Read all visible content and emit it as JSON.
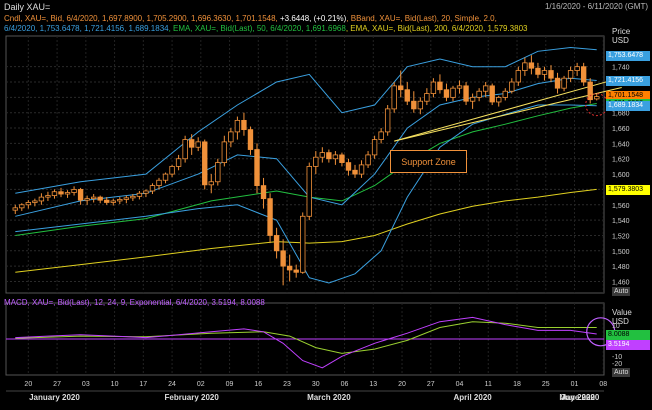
{
  "window": {
    "title": "Daily XAU=",
    "date_range": "1/16/2020 - 6/11/2020 (GMT)"
  },
  "legend": {
    "line1": [
      {
        "text": "Cndl, XAU=, Bid, 6/4/2020, 1,697.8900, 1,705.2900, 1,696.3630, 1,701.1548, ",
        "color": "#f0913a"
      },
      {
        "text": "+3.6448, (+0.21%)",
        "color": "#ffffff"
      },
      {
        "text": ", BBand, XAU=, Bid(Last), 20, Simple, 2.0,",
        "color": "#f0913a"
      }
    ],
    "line2": [
      {
        "text": "6/4/2020, 1,753.6478, 1,721.4156, 1,689.1834",
        "color": "#3aa0e0"
      },
      {
        "text": ", EMA, XAU=, Bid(Last), 50, 6/4/2020, 1,691.6968",
        "color": "#22c040"
      },
      {
        "text": ", EMA, XAU=, Bid(Last), 200, 6/4/2020, 1,579.3803",
        "color": "#e0d020"
      }
    ]
  },
  "price_axis": {
    "title": "Price",
    "unit": "USD",
    "ticks": [
      "1,740",
      "1,720",
      "1,700",
      "1,680",
      "1,660",
      "1,640",
      "1,620",
      "1,600",
      "1,580",
      "1,560",
      "1,540",
      "1,520",
      "1,500",
      "1,480",
      "1,460"
    ],
    "auto_label": "Auto",
    "badges": [
      {
        "value": "1,753.6478",
        "color": "#3aa0e0",
        "text_color": "#ffffff",
        "price": 1753.6
      },
      {
        "value": "1,721.4156",
        "color": "#3aa0e0",
        "text_color": "#ffffff",
        "price": 1721.4
      },
      {
        "value": "1,701.1548",
        "color": "#ff8000",
        "text_color": "#000000",
        "price": 1701.2
      },
      {
        "value": "1,691.6968",
        "color": "#22c040",
        "text_color": "#000000",
        "price": 1691.7
      },
      {
        "value": "1,689.1834",
        "color": "#3aa0e0",
        "text_color": "#ffffff",
        "price": 1689.2
      },
      {
        "value": "1,579.3803",
        "color": "#ffff00",
        "text_color": "#000000",
        "price": 1579.4
      }
    ]
  },
  "annotation": {
    "text": "Support Zone"
  },
  "macd": {
    "legend": "MACD, XAU=, Bid(Last), 12, 24, 9, Exponential, 6/4/2020, 3.5194, 8.0088",
    "axis_title": "Value",
    "unit": "USD",
    "ticks": [
      "10",
      "-10",
      "-20"
    ],
    "auto_label": "Auto",
    "badges": [
      {
        "value": "8.0088",
        "color": "#22c040",
        "text_color": "#000000"
      },
      {
        "value": "3.5194",
        "color": "#c040ff",
        "text_color": "#ffffff"
      }
    ]
  },
  "x_axis": {
    "days": [
      "20",
      "27",
      "03",
      "10",
      "17",
      "24",
      "02",
      "09",
      "16",
      "23",
      "30",
      "06",
      "13",
      "20",
      "27",
      "04",
      "11",
      "18",
      "25",
      "01",
      "08"
    ],
    "months": [
      "January 2020",
      "February 2020",
      "March 2020",
      "April 2020",
      "May 2020",
      "June 2020"
    ]
  },
  "colors": {
    "candle": "#f0913a",
    "bband": "#3aa0e0",
    "ema50": "#22c040",
    "ema200": "#e0d020",
    "macd": "#c040ff",
    "signal": "#9ad030"
  },
  "chart_data": {
    "type": "candlestick",
    "instrument": "XAU=",
    "x_start": "2020-01-16",
    "price_range": [
      1445,
      1780
    ],
    "candles": [
      [
        1553,
        1560,
        1548,
        1556
      ],
      [
        1556,
        1562,
        1552,
        1560
      ],
      [
        1560,
        1566,
        1555,
        1563
      ],
      [
        1563,
        1568,
        1558,
        1565
      ],
      [
        1565,
        1575,
        1560,
        1570
      ],
      [
        1570,
        1577,
        1565,
        1572
      ],
      [
        1572,
        1580,
        1568,
        1577
      ],
      [
        1577,
        1582,
        1570,
        1574
      ],
      [
        1574,
        1579,
        1569,
        1576
      ],
      [
        1576,
        1584,
        1572,
        1580
      ],
      [
        1580,
        1582,
        1560,
        1566
      ],
      [
        1566,
        1572,
        1560,
        1568
      ],
      [
        1568,
        1574,
        1563,
        1570
      ],
      [
        1570,
        1572,
        1562,
        1566
      ],
      [
        1566,
        1570,
        1560,
        1563
      ],
      [
        1563,
        1568,
        1559,
        1565
      ],
      [
        1565,
        1570,
        1561,
        1567
      ],
      [
        1567,
        1572,
        1562,
        1569
      ],
      [
        1569,
        1574,
        1565,
        1571
      ],
      [
        1571,
        1578,
        1567,
        1575
      ],
      [
        1575,
        1580,
        1570,
        1578
      ],
      [
        1578,
        1588,
        1574,
        1585
      ],
      [
        1585,
        1595,
        1580,
        1592
      ],
      [
        1592,
        1602,
        1588,
        1600
      ],
      [
        1600,
        1612,
        1596,
        1610
      ],
      [
        1610,
        1625,
        1605,
        1620
      ],
      [
        1620,
        1650,
        1615,
        1645
      ],
      [
        1645,
        1652,
        1625,
        1635
      ],
      [
        1635,
        1648,
        1630,
        1642
      ],
      [
        1642,
        1645,
        1580,
        1586
      ],
      [
        1586,
        1600,
        1575,
        1590
      ],
      [
        1590,
        1620,
        1585,
        1615
      ],
      [
        1615,
        1650,
        1610,
        1642
      ],
      [
        1642,
        1660,
        1635,
        1655
      ],
      [
        1655,
        1675,
        1645,
        1670
      ],
      [
        1670,
        1680,
        1650,
        1658
      ],
      [
        1658,
        1662,
        1625,
        1632
      ],
      [
        1632,
        1640,
        1575,
        1585
      ],
      [
        1585,
        1595,
        1555,
        1568
      ],
      [
        1568,
        1575,
        1510,
        1520
      ],
      [
        1520,
        1530,
        1490,
        1500
      ],
      [
        1500,
        1515,
        1455,
        1480
      ],
      [
        1480,
        1495,
        1460,
        1475
      ],
      [
        1475,
        1482,
        1465,
        1472
      ],
      [
        1472,
        1550,
        1470,
        1545
      ],
      [
        1545,
        1615,
        1540,
        1610
      ],
      [
        1610,
        1630,
        1600,
        1622
      ],
      [
        1622,
        1635,
        1615,
        1628
      ],
      [
        1628,
        1632,
        1615,
        1620
      ],
      [
        1620,
        1630,
        1612,
        1625
      ],
      [
        1625,
        1628,
        1610,
        1615
      ],
      [
        1615,
        1620,
        1598,
        1605
      ],
      [
        1605,
        1612,
        1595,
        1600
      ],
      [
        1600,
        1618,
        1595,
        1612
      ],
      [
        1612,
        1630,
        1608,
        1625
      ],
      [
        1625,
        1650,
        1620,
        1645
      ],
      [
        1645,
        1660,
        1640,
        1655
      ],
      [
        1655,
        1690,
        1650,
        1685
      ],
      [
        1685,
        1720,
        1680,
        1715
      ],
      [
        1715,
        1735,
        1700,
        1710
      ],
      [
        1710,
        1720,
        1690,
        1695
      ],
      [
        1695,
        1708,
        1680,
        1685
      ],
      [
        1685,
        1700,
        1678,
        1695
      ],
      [
        1695,
        1712,
        1690,
        1705
      ],
      [
        1705,
        1725,
        1700,
        1720
      ],
      [
        1720,
        1730,
        1705,
        1710
      ],
      [
        1710,
        1718,
        1695,
        1700
      ],
      [
        1700,
        1715,
        1695,
        1712
      ],
      [
        1712,
        1722,
        1705,
        1715
      ],
      [
        1715,
        1720,
        1690,
        1695
      ],
      [
        1695,
        1705,
        1685,
        1700
      ],
      [
        1700,
        1712,
        1695,
        1708
      ],
      [
        1708,
        1720,
        1700,
        1715
      ],
      [
        1715,
        1718,
        1690,
        1694
      ],
      [
        1694,
        1702,
        1688,
        1700
      ],
      [
        1700,
        1712,
        1696,
        1708
      ],
      [
        1708,
        1725,
        1705,
        1720
      ],
      [
        1720,
        1740,
        1715,
        1735
      ],
      [
        1735,
        1752,
        1728,
        1745
      ],
      [
        1745,
        1755,
        1730,
        1738
      ],
      [
        1738,
        1745,
        1725,
        1730
      ],
      [
        1730,
        1740,
        1722,
        1735
      ],
      [
        1735,
        1742,
        1720,
        1725
      ],
      [
        1725,
        1732,
        1705,
        1712
      ],
      [
        1712,
        1728,
        1708,
        1725
      ],
      [
        1725,
        1740,
        1720,
        1735
      ],
      [
        1735,
        1745,
        1728,
        1740
      ],
      [
        1740,
        1745,
        1715,
        1720
      ],
      [
        1720,
        1725,
        1692,
        1697
      ],
      [
        1698,
        1705,
        1696,
        1701
      ]
    ],
    "bband_upper": [
      [
        0,
        1575
      ],
      [
        10,
        1590
      ],
      [
        20,
        1600
      ],
      [
        28,
        1655
      ],
      [
        34,
        1690
      ],
      [
        40,
        1720
      ],
      [
        45,
        1730
      ],
      [
        50,
        1680
      ],
      [
        55,
        1690
      ],
      [
        60,
        1740
      ],
      [
        65,
        1750
      ],
      [
        70,
        1740
      ],
      [
        75,
        1740
      ],
      [
        80,
        1760
      ],
      [
        85,
        1765
      ],
      [
        89,
        1762
      ]
    ],
    "bband_middle": [
      [
        0,
        1545
      ],
      [
        10,
        1565
      ],
      [
        20,
        1575
      ],
      [
        28,
        1600
      ],
      [
        34,
        1625
      ],
      [
        40,
        1620
      ],
      [
        45,
        1570
      ],
      [
        50,
        1560
      ],
      [
        55,
        1600
      ],
      [
        60,
        1660
      ],
      [
        65,
        1690
      ],
      [
        70,
        1700
      ],
      [
        75,
        1705
      ],
      [
        80,
        1718
      ],
      [
        85,
        1725
      ],
      [
        89,
        1722
      ]
    ],
    "bband_lower": [
      [
        0,
        1525
      ],
      [
        10,
        1535
      ],
      [
        20,
        1545
      ],
      [
        28,
        1555
      ],
      [
        34,
        1560
      ],
      [
        40,
        1540
      ],
      [
        45,
        1465
      ],
      [
        48,
        1458
      ],
      [
        52,
        1470
      ],
      [
        56,
        1500
      ],
      [
        60,
        1570
      ],
      [
        65,
        1635
      ],
      [
        70,
        1665
      ],
      [
        75,
        1678
      ],
      [
        80,
        1690
      ],
      [
        85,
        1690
      ],
      [
        89,
        1689
      ]
    ],
    "ema50": [
      [
        0,
        1520
      ],
      [
        10,
        1532
      ],
      [
        20,
        1542
      ],
      [
        30,
        1565
      ],
      [
        40,
        1578
      ],
      [
        45,
        1570
      ],
      [
        50,
        1565
      ],
      [
        55,
        1585
      ],
      [
        60,
        1615
      ],
      [
        65,
        1640
      ],
      [
        70,
        1655
      ],
      [
        75,
        1665
      ],
      [
        80,
        1676
      ],
      [
        85,
        1686
      ],
      [
        89,
        1692
      ]
    ],
    "ema200": [
      [
        0,
        1472
      ],
      [
        10,
        1482
      ],
      [
        20,
        1492
      ],
      [
        30,
        1503
      ],
      [
        40,
        1512
      ],
      [
        45,
        1510
      ],
      [
        50,
        1512
      ],
      [
        55,
        1520
      ],
      [
        60,
        1535
      ],
      [
        65,
        1548
      ],
      [
        70,
        1558
      ],
      [
        75,
        1565
      ],
      [
        80,
        1570
      ],
      [
        85,
        1576
      ],
      [
        89,
        1580
      ]
    ],
    "support_lines": [
      [
        [
          58,
          1643
        ],
        [
          89,
          1718
        ]
      ],
      [
        [
          58,
          1643
        ],
        [
          89,
          1705
        ]
      ]
    ],
    "macd_range": [
      -25,
      25
    ],
    "macd": [
      [
        0,
        1
      ],
      [
        5,
        2
      ],
      [
        10,
        3
      ],
      [
        15,
        2
      ],
      [
        20,
        1
      ],
      [
        25,
        3
      ],
      [
        30,
        5
      ],
      [
        35,
        7
      ],
      [
        38,
        5
      ],
      [
        41,
        -3
      ],
      [
        44,
        -15
      ],
      [
        47,
        -20
      ],
      [
        50,
        -12
      ],
      [
        55,
        -3
      ],
      [
        60,
        4
      ],
      [
        65,
        12
      ],
      [
        70,
        15
      ],
      [
        75,
        10
      ],
      [
        80,
        6
      ],
      [
        85,
        6
      ],
      [
        89,
        3.5
      ]
    ],
    "signal": [
      [
        0,
        0.5
      ],
      [
        10,
        2
      ],
      [
        20,
        1.5
      ],
      [
        30,
        4
      ],
      [
        38,
        5
      ],
      [
        42,
        2
      ],
      [
        46,
        -6
      ],
      [
        50,
        -10
      ],
      [
        55,
        -7
      ],
      [
        60,
        -1
      ],
      [
        65,
        8
      ],
      [
        70,
        12
      ],
      [
        75,
        11
      ],
      [
        80,
        8
      ],
      [
        85,
        8
      ],
      [
        89,
        8
      ]
    ],
    "series": [
      {
        "name": "Cndl, XAU=, Bid"
      },
      {
        "name": "BBand, XAU=, Bid(Last), 20, Simple, 2.0"
      },
      {
        "name": "EMA, XAU=, Bid(Last), 50"
      },
      {
        "name": "EMA, XAU=, Bid(Last), 200"
      },
      {
        "name": "MACD, XAU=, Bid(Last), 12, 24, 9, Exponential"
      }
    ]
  }
}
